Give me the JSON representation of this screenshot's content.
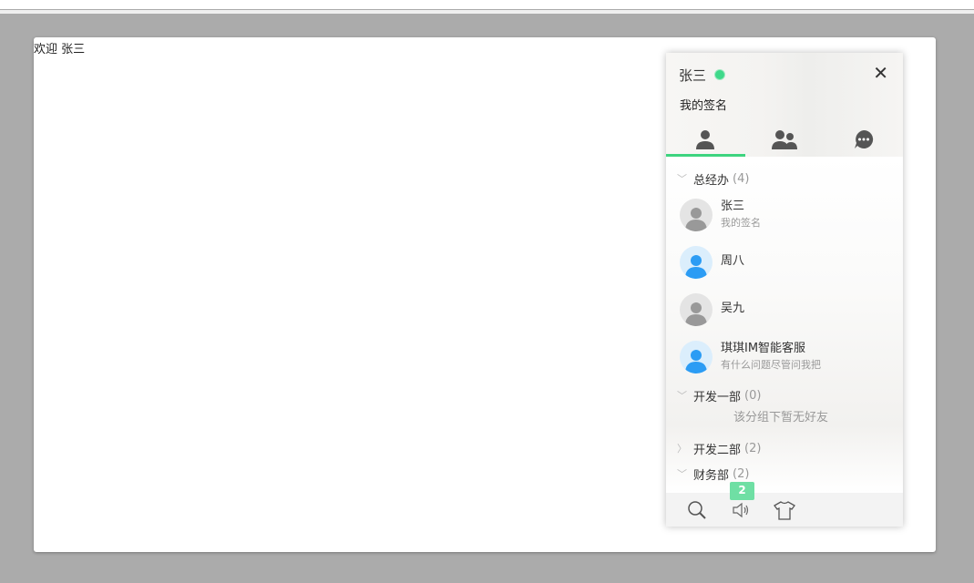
{
  "page": {
    "welcome": "欢迎 张三"
  },
  "panel": {
    "user": {
      "name": "张三",
      "status_color": "#3fd98a",
      "signature": "我的签名"
    },
    "tabs": [
      {
        "icon": "user-icon",
        "active": true
      },
      {
        "icon": "group-icon"
      },
      {
        "icon": "chat-icon"
      }
    ],
    "groups": [
      {
        "name": "总经办",
        "count": "(4)",
        "expanded": true,
        "members": [
          {
            "name": "张三",
            "signature": "我的签名",
            "avatar": "gray"
          },
          {
            "name": "周八",
            "signature": "",
            "avatar": "blue"
          },
          {
            "name": "吴九",
            "signature": "",
            "avatar": "gray"
          },
          {
            "name": "琪琪IM智能客服",
            "signature": "有什么问题尽管问我把",
            "avatar": "blue"
          }
        ]
      },
      {
        "name": "开发一部",
        "count": "(0)",
        "expanded": true,
        "empty_text": "该分组下暂无好友"
      },
      {
        "name": "开发二部",
        "count": "(2)",
        "expanded": false
      },
      {
        "name": "财务部",
        "count": "(2)",
        "expanded": true
      }
    ],
    "footer": {
      "notice_badge": "2"
    }
  }
}
